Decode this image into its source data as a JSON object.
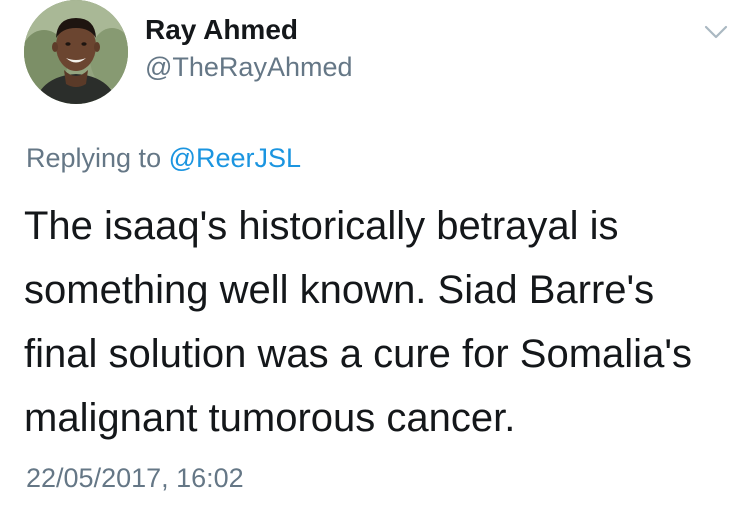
{
  "tweet": {
    "author": {
      "name": "Ray Ahmed",
      "handle": "@TheRayAhmed",
      "avatar_icon": "profile-photo"
    },
    "menu_icon": "chevron-down-icon",
    "reply": {
      "prefix": "Replying to",
      "handle": "@ReerJSL"
    },
    "text": "The isaaq's historically betrayal is something well known. Siad Barre's final solution was a cure for Somalia's malignant tumorous cancer.",
    "timestamp": "22/05/2017, 16:02"
  },
  "colors": {
    "primary_text": "#14171a",
    "secondary_text": "#657786",
    "link": "#1b95e0",
    "chevron": "#aab8c2"
  }
}
